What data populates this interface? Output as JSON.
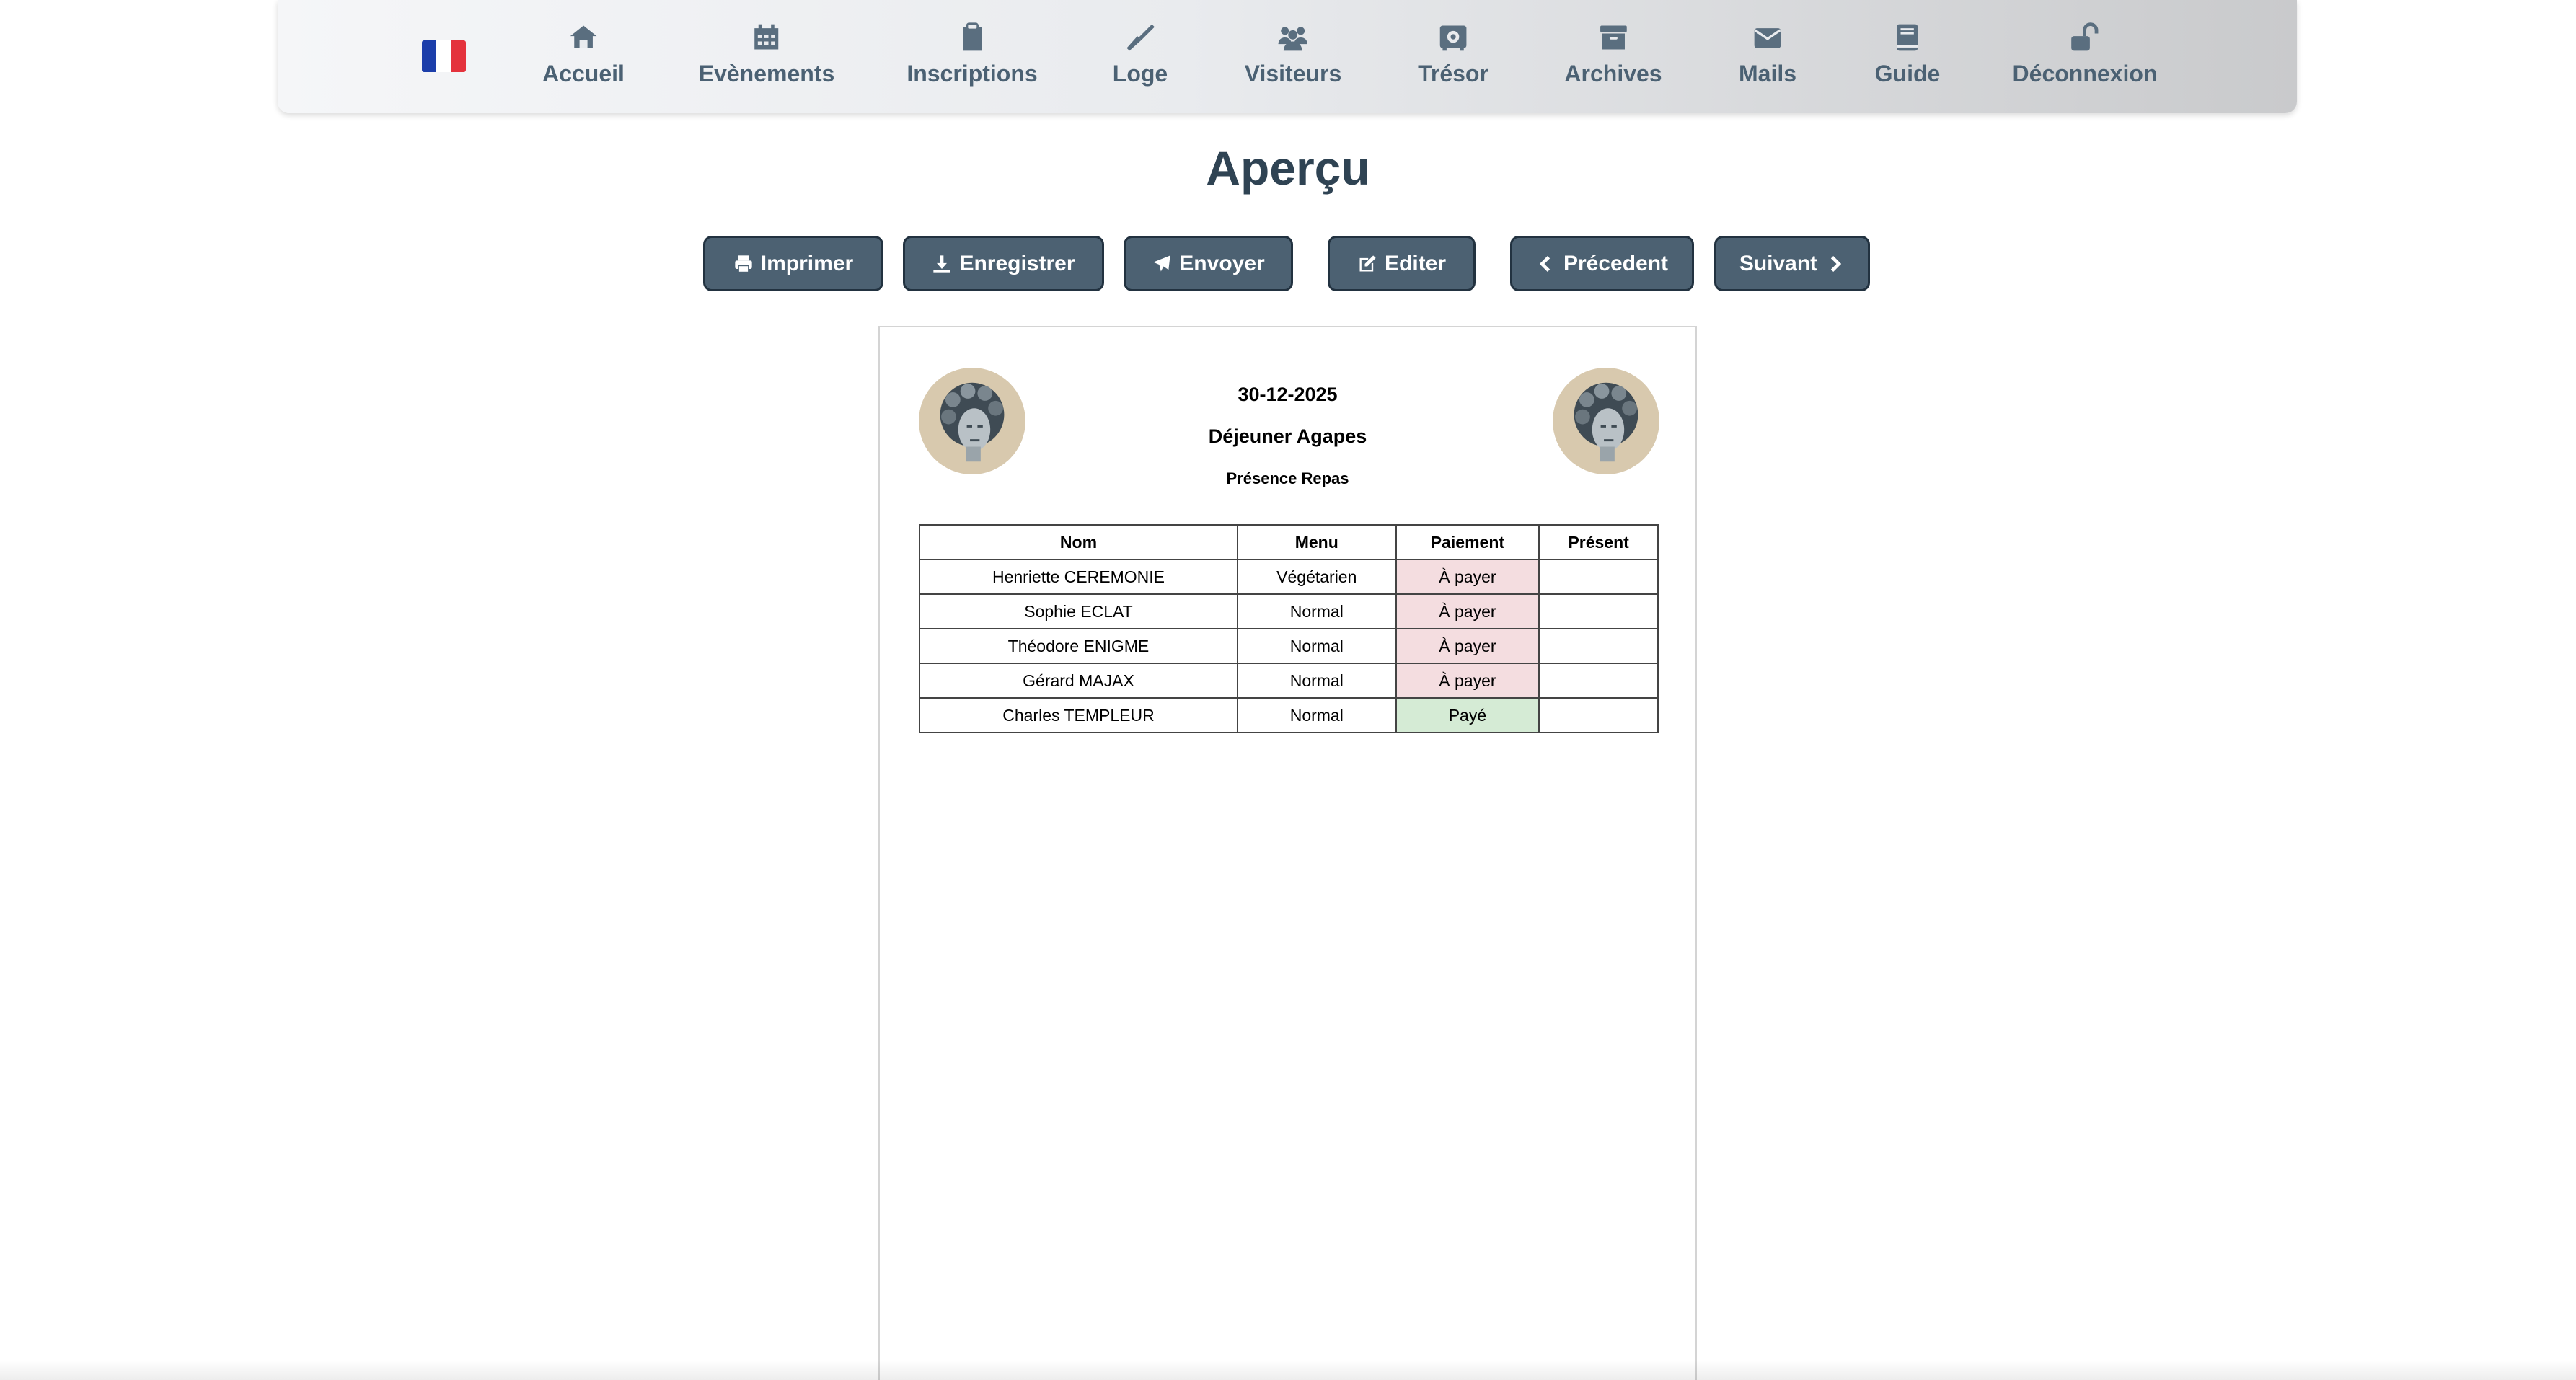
{
  "nav": {
    "items": [
      {
        "label": "Accueil",
        "icon": "home-icon"
      },
      {
        "label": "Evènements",
        "icon": "calendar-icon"
      },
      {
        "label": "Inscriptions",
        "icon": "clipboard-icon"
      },
      {
        "label": "Loge",
        "icon": "trowel-icon"
      },
      {
        "label": "Visiteurs",
        "icon": "users-icon"
      },
      {
        "label": "Trésor",
        "icon": "safe-icon"
      },
      {
        "label": "Archives",
        "icon": "archive-box-icon"
      },
      {
        "label": "Mails",
        "icon": "envelope-icon"
      },
      {
        "label": "Guide",
        "icon": "book-icon"
      },
      {
        "label": "Déconnexion",
        "icon": "unlock-icon"
      }
    ]
  },
  "page": {
    "title": "Aperçu"
  },
  "actions": {
    "print": "Imprimer",
    "save": "Enregistrer",
    "send": "Envoyer",
    "edit": "Editer",
    "previous": "Précedent",
    "next": "Suivant"
  },
  "document": {
    "date": "30-12-2025",
    "event": "Déjeuner Agapes",
    "subtitle": "Présence Repas",
    "table": {
      "headers": [
        "Nom",
        "Menu",
        "Paiement",
        "Présent"
      ],
      "rows": [
        [
          "Henriette CEREMONIE",
          "Végétarien",
          "À payer",
          ""
        ],
        [
          "Sophie ECLAT",
          "Normal",
          "À payer",
          ""
        ],
        [
          "Théodore ENIGME",
          "Normal",
          "À payer",
          ""
        ],
        [
          "Gérard MAJAX",
          "Normal",
          "À payer",
          ""
        ],
        [
          "Charles TEMPLEUR",
          "Normal",
          "Payé",
          ""
        ]
      ]
    }
  },
  "colors": {
    "button_bg": "#4c6172",
    "nav_text": "#4b6173",
    "unpaid_bg": "#f4dde0",
    "paid_bg": "#d5ebd5"
  }
}
